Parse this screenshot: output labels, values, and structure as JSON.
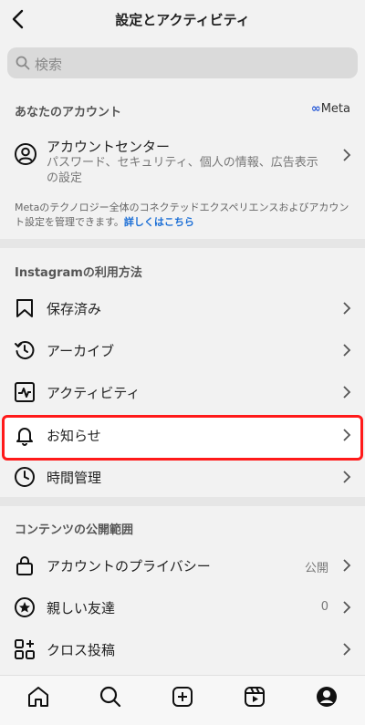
{
  "header": {
    "title": "設定とアクティビティ"
  },
  "search": {
    "placeholder": "検索"
  },
  "account_section": {
    "title": "あなたのアカウント",
    "brand": "Meta",
    "center_title": "アカウントセンター",
    "center_sub": "パスワード、セキュリティ、個人の情報、広告表示の設定",
    "note_text": "Metaのテクノロジー全体のコネクテッドエクスペリエンスおよびアカウント設定を管理できます。",
    "note_link": "詳しくはこちら"
  },
  "usage_section": {
    "title": "Instagramの利用方法",
    "items": [
      {
        "label": "保存済み",
        "icon": "bookmark-icon"
      },
      {
        "label": "アーカイブ",
        "icon": "archive-icon"
      },
      {
        "label": "アクティビティ",
        "icon": "activity-icon"
      },
      {
        "label": "お知らせ",
        "icon": "bell-icon"
      },
      {
        "label": "時間管理",
        "icon": "clock-icon"
      }
    ]
  },
  "privacy_section": {
    "title": "コンテンツの公開範囲",
    "items": [
      {
        "label": "アカウントのプライバシー",
        "value": "公開",
        "icon": "lock-icon"
      },
      {
        "label": "親しい友達",
        "value": "0",
        "icon": "star-circle-icon"
      },
      {
        "label": "クロス投稿",
        "icon": "grid-add-icon"
      }
    ]
  },
  "tabbar": {
    "icons": [
      "home-icon",
      "search-icon",
      "create-icon",
      "reels-icon",
      "profile-icon"
    ]
  },
  "colors": {
    "highlight": "#ff1a1a",
    "link": "#1c6fd6"
  }
}
